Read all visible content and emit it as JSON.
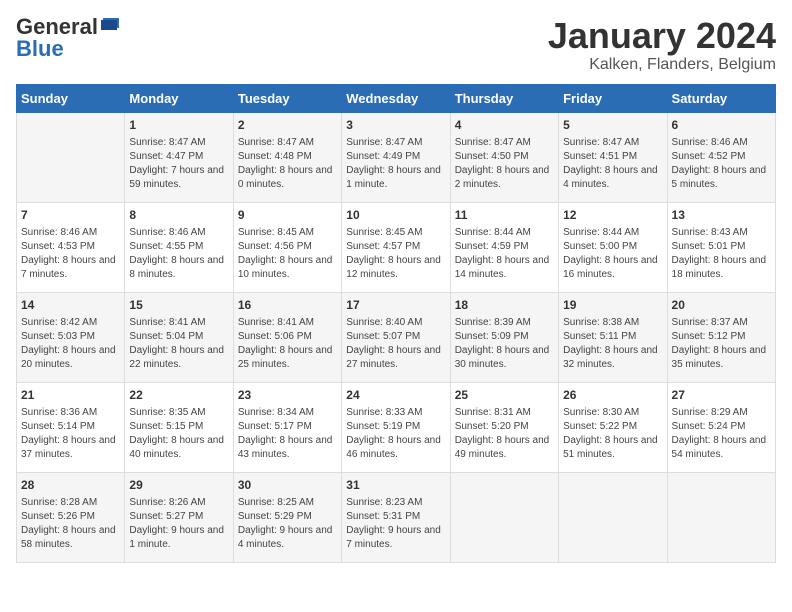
{
  "header": {
    "logo_general": "General",
    "logo_blue": "Blue",
    "month": "January 2024",
    "location": "Kalken, Flanders, Belgium"
  },
  "days_of_week": [
    "Sunday",
    "Monday",
    "Tuesday",
    "Wednesday",
    "Thursday",
    "Friday",
    "Saturday"
  ],
  "weeks": [
    [
      {
        "day": "",
        "sunrise": "",
        "sunset": "",
        "daylight": ""
      },
      {
        "day": "1",
        "sunrise": "Sunrise: 8:47 AM",
        "sunset": "Sunset: 4:47 PM",
        "daylight": "Daylight: 7 hours and 59 minutes."
      },
      {
        "day": "2",
        "sunrise": "Sunrise: 8:47 AM",
        "sunset": "Sunset: 4:48 PM",
        "daylight": "Daylight: 8 hours and 0 minutes."
      },
      {
        "day": "3",
        "sunrise": "Sunrise: 8:47 AM",
        "sunset": "Sunset: 4:49 PM",
        "daylight": "Daylight: 8 hours and 1 minute."
      },
      {
        "day": "4",
        "sunrise": "Sunrise: 8:47 AM",
        "sunset": "Sunset: 4:50 PM",
        "daylight": "Daylight: 8 hours and 2 minutes."
      },
      {
        "day": "5",
        "sunrise": "Sunrise: 8:47 AM",
        "sunset": "Sunset: 4:51 PM",
        "daylight": "Daylight: 8 hours and 4 minutes."
      },
      {
        "day": "6",
        "sunrise": "Sunrise: 8:46 AM",
        "sunset": "Sunset: 4:52 PM",
        "daylight": "Daylight: 8 hours and 5 minutes."
      }
    ],
    [
      {
        "day": "7",
        "sunrise": "Sunrise: 8:46 AM",
        "sunset": "Sunset: 4:53 PM",
        "daylight": "Daylight: 8 hours and 7 minutes."
      },
      {
        "day": "8",
        "sunrise": "Sunrise: 8:46 AM",
        "sunset": "Sunset: 4:55 PM",
        "daylight": "Daylight: 8 hours and 8 minutes."
      },
      {
        "day": "9",
        "sunrise": "Sunrise: 8:45 AM",
        "sunset": "Sunset: 4:56 PM",
        "daylight": "Daylight: 8 hours and 10 minutes."
      },
      {
        "day": "10",
        "sunrise": "Sunrise: 8:45 AM",
        "sunset": "Sunset: 4:57 PM",
        "daylight": "Daylight: 8 hours and 12 minutes."
      },
      {
        "day": "11",
        "sunrise": "Sunrise: 8:44 AM",
        "sunset": "Sunset: 4:59 PM",
        "daylight": "Daylight: 8 hours and 14 minutes."
      },
      {
        "day": "12",
        "sunrise": "Sunrise: 8:44 AM",
        "sunset": "Sunset: 5:00 PM",
        "daylight": "Daylight: 8 hours and 16 minutes."
      },
      {
        "day": "13",
        "sunrise": "Sunrise: 8:43 AM",
        "sunset": "Sunset: 5:01 PM",
        "daylight": "Daylight: 8 hours and 18 minutes."
      }
    ],
    [
      {
        "day": "14",
        "sunrise": "Sunrise: 8:42 AM",
        "sunset": "Sunset: 5:03 PM",
        "daylight": "Daylight: 8 hours and 20 minutes."
      },
      {
        "day": "15",
        "sunrise": "Sunrise: 8:41 AM",
        "sunset": "Sunset: 5:04 PM",
        "daylight": "Daylight: 8 hours and 22 minutes."
      },
      {
        "day": "16",
        "sunrise": "Sunrise: 8:41 AM",
        "sunset": "Sunset: 5:06 PM",
        "daylight": "Daylight: 8 hours and 25 minutes."
      },
      {
        "day": "17",
        "sunrise": "Sunrise: 8:40 AM",
        "sunset": "Sunset: 5:07 PM",
        "daylight": "Daylight: 8 hours and 27 minutes."
      },
      {
        "day": "18",
        "sunrise": "Sunrise: 8:39 AM",
        "sunset": "Sunset: 5:09 PM",
        "daylight": "Daylight: 8 hours and 30 minutes."
      },
      {
        "day": "19",
        "sunrise": "Sunrise: 8:38 AM",
        "sunset": "Sunset: 5:11 PM",
        "daylight": "Daylight: 8 hours and 32 minutes."
      },
      {
        "day": "20",
        "sunrise": "Sunrise: 8:37 AM",
        "sunset": "Sunset: 5:12 PM",
        "daylight": "Daylight: 8 hours and 35 minutes."
      }
    ],
    [
      {
        "day": "21",
        "sunrise": "Sunrise: 8:36 AM",
        "sunset": "Sunset: 5:14 PM",
        "daylight": "Daylight: 8 hours and 37 minutes."
      },
      {
        "day": "22",
        "sunrise": "Sunrise: 8:35 AM",
        "sunset": "Sunset: 5:15 PM",
        "daylight": "Daylight: 8 hours and 40 minutes."
      },
      {
        "day": "23",
        "sunrise": "Sunrise: 8:34 AM",
        "sunset": "Sunset: 5:17 PM",
        "daylight": "Daylight: 8 hours and 43 minutes."
      },
      {
        "day": "24",
        "sunrise": "Sunrise: 8:33 AM",
        "sunset": "Sunset: 5:19 PM",
        "daylight": "Daylight: 8 hours and 46 minutes."
      },
      {
        "day": "25",
        "sunrise": "Sunrise: 8:31 AM",
        "sunset": "Sunset: 5:20 PM",
        "daylight": "Daylight: 8 hours and 49 minutes."
      },
      {
        "day": "26",
        "sunrise": "Sunrise: 8:30 AM",
        "sunset": "Sunset: 5:22 PM",
        "daylight": "Daylight: 8 hours and 51 minutes."
      },
      {
        "day": "27",
        "sunrise": "Sunrise: 8:29 AM",
        "sunset": "Sunset: 5:24 PM",
        "daylight": "Daylight: 8 hours and 54 minutes."
      }
    ],
    [
      {
        "day": "28",
        "sunrise": "Sunrise: 8:28 AM",
        "sunset": "Sunset: 5:26 PM",
        "daylight": "Daylight: 8 hours and 58 minutes."
      },
      {
        "day": "29",
        "sunrise": "Sunrise: 8:26 AM",
        "sunset": "Sunset: 5:27 PM",
        "daylight": "Daylight: 9 hours and 1 minute."
      },
      {
        "day": "30",
        "sunrise": "Sunrise: 8:25 AM",
        "sunset": "Sunset: 5:29 PM",
        "daylight": "Daylight: 9 hours and 4 minutes."
      },
      {
        "day": "31",
        "sunrise": "Sunrise: 8:23 AM",
        "sunset": "Sunset: 5:31 PM",
        "daylight": "Daylight: 9 hours and 7 minutes."
      },
      {
        "day": "",
        "sunrise": "",
        "sunset": "",
        "daylight": ""
      },
      {
        "day": "",
        "sunrise": "",
        "sunset": "",
        "daylight": ""
      },
      {
        "day": "",
        "sunrise": "",
        "sunset": "",
        "daylight": ""
      }
    ]
  ]
}
